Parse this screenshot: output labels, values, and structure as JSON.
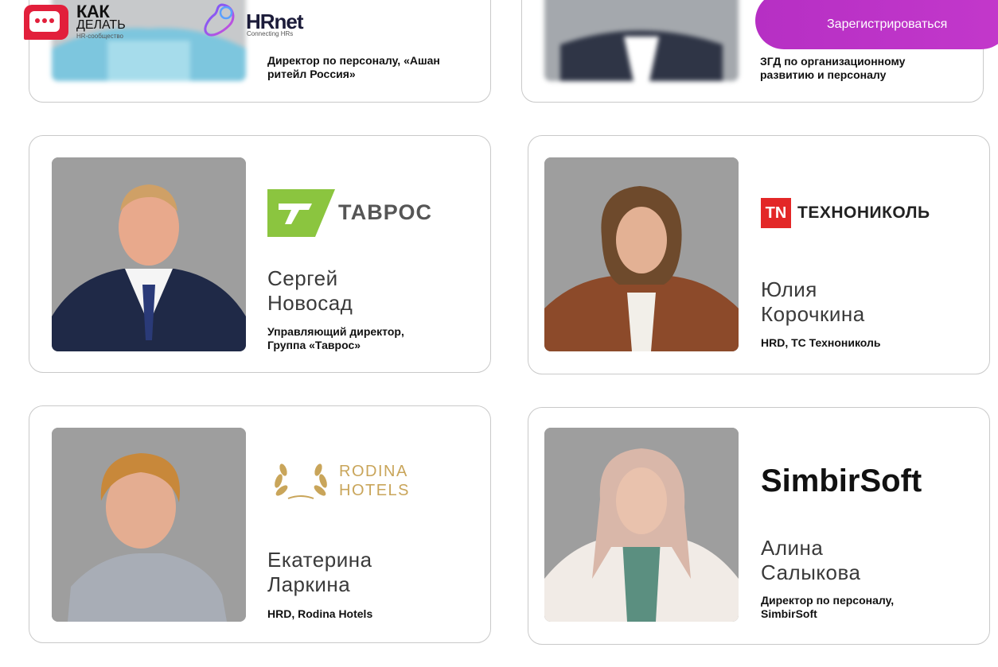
{
  "header": {
    "logo_kak": {
      "line1": "КАК",
      "line2": "ДЕЛАТЬ",
      "sub": "HR-сообщество"
    },
    "logo_hrnet": {
      "title": "HRnet",
      "sub": "Connecting HRs"
    },
    "register_label": "Зарегистрироваться"
  },
  "cards": [
    {
      "role": "Директор по персоналу, «Ашан ритейл Россия»"
    },
    {
      "role": "ЗГД по организационному развитию и персоналу"
    },
    {
      "name_first": "Сергей",
      "name_last": "Новосад",
      "role_line1": "Управляющий директор,",
      "role_line2": "Группа «Таврос»",
      "company_logo": "ТАВРОС"
    },
    {
      "name_first": "Юлия",
      "name_last": "Корочкина",
      "role_line1": "HRD, ТС Технониколь",
      "company_logo": "ТЕХНОНИКОЛЬ",
      "company_logo_mark": "TN"
    },
    {
      "name_first": "Екатерина",
      "name_last": "Ларкина",
      "role_line1": "HRD, Rodina Hotels",
      "company_logo_line1": "RODINA",
      "company_logo_line2": "HOTELS"
    },
    {
      "name_first": "Алина",
      "name_last": "Салыкова",
      "role_line1": "Директор по персоналу,",
      "role_line2": "SimbirSoft",
      "company_logo": "SimbirSoft"
    }
  ],
  "colors": {
    "accent": "#c338cb",
    "tavros_green": "#8bc53f",
    "technonikol_red": "#e32727",
    "rodina_gold": "#c9a55a"
  }
}
